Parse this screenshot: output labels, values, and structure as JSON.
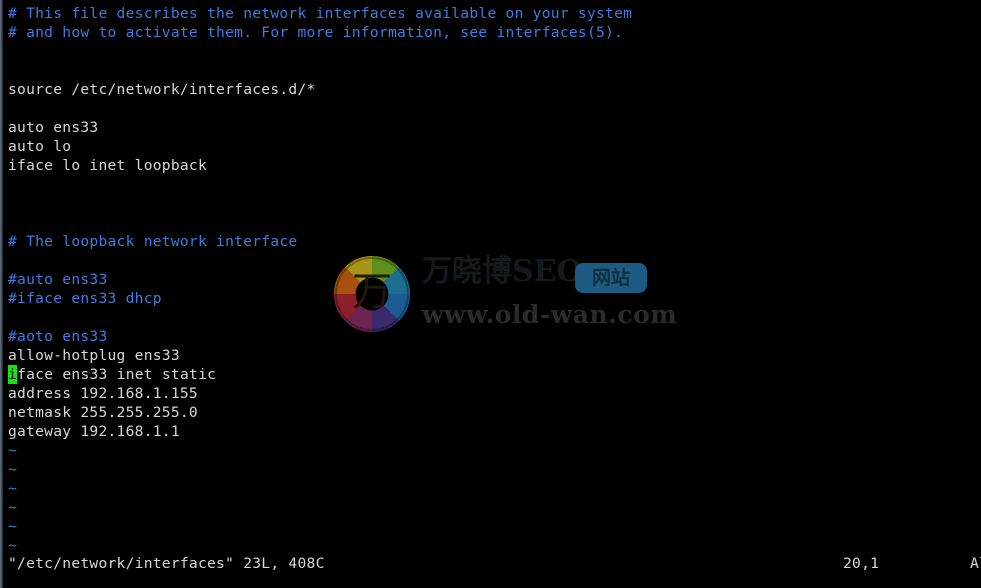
{
  "terminal": {
    "app": "vim",
    "background": "#000000",
    "foreground": "#d8d8d8",
    "comment_color": "#3d7ce0",
    "tilde_color": "#2e7fd6",
    "cursor_color": "#13e512"
  },
  "buffer": {
    "lines": [
      {
        "text": "# This file describes the network interfaces available on your system",
        "style": "comment"
      },
      {
        "text": "# and how to activate them. For more information, see interfaces(5).",
        "style": "comment"
      },
      {
        "text": "",
        "style": "txt"
      },
      {
        "text": "",
        "style": "txt"
      },
      {
        "text": "source /etc/network/interfaces.d/*",
        "style": "txt"
      },
      {
        "text": "",
        "style": "txt"
      },
      {
        "text": "auto ens33",
        "style": "txt"
      },
      {
        "text": "auto lo",
        "style": "txt"
      },
      {
        "text": "iface lo inet loopback",
        "style": "txt"
      },
      {
        "text": "",
        "style": "txt"
      },
      {
        "text": "",
        "style": "txt"
      },
      {
        "text": "",
        "style": "txt"
      },
      {
        "text": "# The loopback network interface",
        "style": "comment"
      },
      {
        "text": "",
        "style": "txt"
      },
      {
        "text": "#auto ens33",
        "style": "comment"
      },
      {
        "text": "#iface ens33 dhcp",
        "style": "comment"
      },
      {
        "text": "",
        "style": "txt"
      },
      {
        "text": "#aoto ens33",
        "style": "comment"
      },
      {
        "text": "allow-hotplug ens33",
        "style": "txt"
      },
      {
        "text": "iface ens33 inet static",
        "style": "txt",
        "cursor_col": 0
      },
      {
        "text": "address 192.168.1.155",
        "style": "txt"
      },
      {
        "text": "netmask 255.255.255.0",
        "style": "txt"
      },
      {
        "text": "gateway 192.168.1.1",
        "style": "txt"
      },
      {
        "text": "~",
        "style": "tilde"
      },
      {
        "text": "~",
        "style": "tilde"
      },
      {
        "text": "~",
        "style": "tilde"
      },
      {
        "text": "~",
        "style": "tilde"
      },
      {
        "text": "~",
        "style": "tilde"
      },
      {
        "text": "~",
        "style": "tilde"
      }
    ]
  },
  "status": {
    "file_info": "\"/etc/network/interfaces\" 23L, 408C",
    "position": "20,1",
    "scroll": "All"
  },
  "watermark": {
    "brand": "万晓博SEO",
    "badge": "网站",
    "url": "www.old-wan.com",
    "logo_glyph": "万",
    "badge_color": "#1d5b84",
    "logo_colors": [
      "#7a9a1e",
      "#3d7a22",
      "#146b8c",
      "#1a5c93",
      "#3d2a6b",
      "#6b2450",
      "#8c1f2a",
      "#b06a14",
      "#a8941a"
    ]
  }
}
